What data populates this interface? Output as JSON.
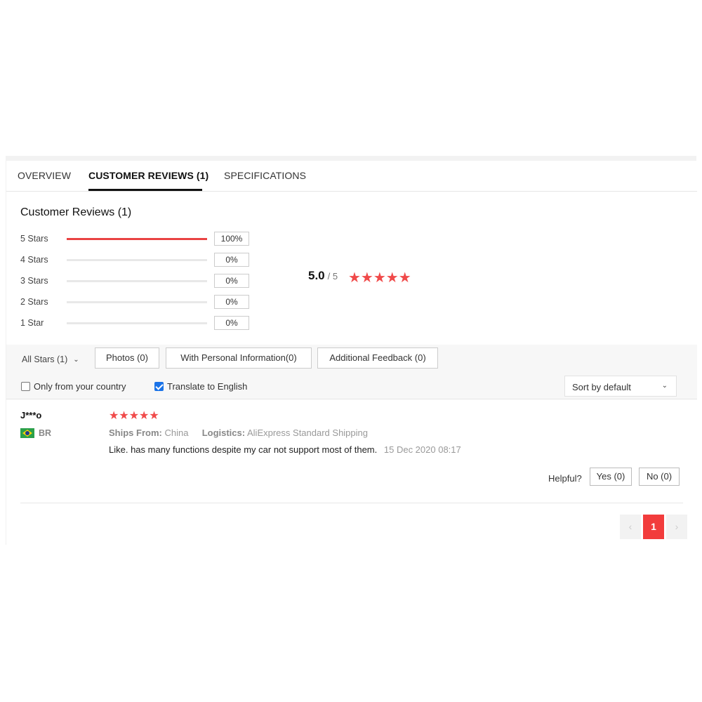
{
  "tabs": [
    {
      "label": "OVERVIEW"
    },
    {
      "label": "CUSTOMER REVIEWS (1)"
    },
    {
      "label": "SPECIFICATIONS"
    }
  ],
  "summary": {
    "title": "Customer Reviews (1)",
    "distribution": [
      {
        "label": "5 Stars",
        "percent": "100%",
        "fill": 1.0
      },
      {
        "label": "4 Stars",
        "percent": "0%",
        "fill": 0
      },
      {
        "label": "3 Stars",
        "percent": "0%",
        "fill": 0
      },
      {
        "label": "2 Stars",
        "percent": "0%",
        "fill": 0
      },
      {
        "label": "1 Star",
        "percent": "0%",
        "fill": 0
      }
    ],
    "average": "5.0",
    "average_outof": "/ 5",
    "average_stars": "★★★★★",
    "rating_value": 5,
    "star_color": "#f04a4a",
    "bar_color": "#e94343"
  },
  "filters": {
    "all_stars": "All Stars (1)",
    "buttons": [
      {
        "label": "Photos (0)"
      },
      {
        "label": "With Personal Information(0)"
      },
      {
        "label": "Additional Feedback (0)"
      }
    ],
    "only_country": "Only from your country",
    "only_country_checked": false,
    "translate": "Translate to English",
    "translate_checked": true,
    "sort": "Sort by default"
  },
  "review": {
    "user": "J***o",
    "country": "BR",
    "stars": "★★★★★",
    "ships_from_label": "Ships From:",
    "ships_from": "China",
    "logistics_label": "Logistics:",
    "logistics": "AliExpress Standard Shipping",
    "text": "Like. has many functions despite my car not support most of them.",
    "date": "15 Dec 2020 08:17",
    "helpful_label": "Helpful?",
    "yes": "Yes (0)",
    "no": "No (0)"
  },
  "pagination": {
    "prev": "‹",
    "current": "1",
    "next": "›",
    "accent": "#f23c3c"
  },
  "icons": {
    "chevron_down": "⌄"
  }
}
